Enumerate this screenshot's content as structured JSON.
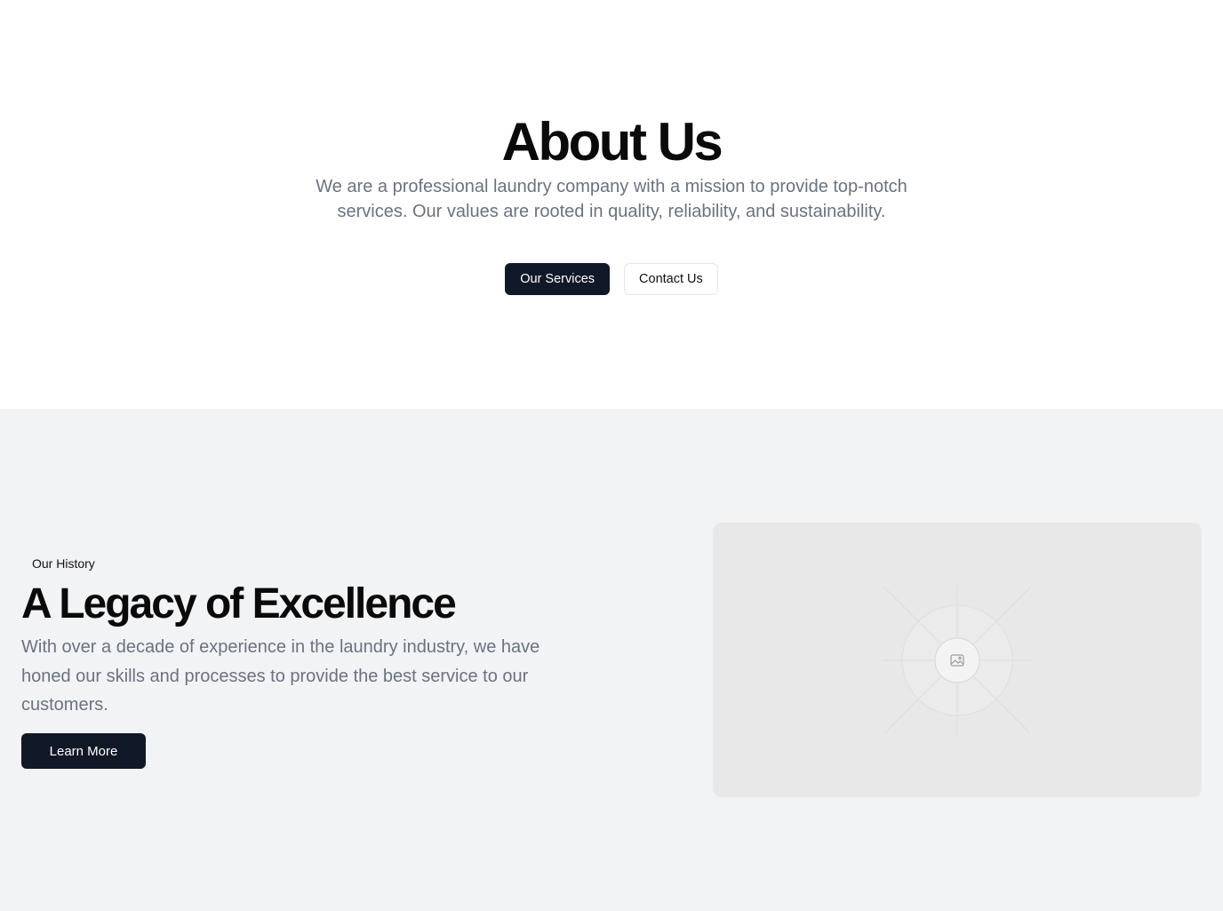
{
  "hero": {
    "title": "About Us",
    "description": "We are a professional laundry company with a mission to provide top-notch services. Our values are rooted in quality, reliability, and sustainability.",
    "primary_button": "Our Services",
    "secondary_button": "Contact Us"
  },
  "history": {
    "eyebrow": "Our History",
    "title": "A Legacy of Excellence",
    "description": "With over a decade of experience in the laundry industry, we have honed our skills and processes to provide the best service to our customers.",
    "button": "Learn More",
    "image_icon": "image-placeholder-icon"
  },
  "colors": {
    "dark_button": "#111827",
    "muted_text": "#6b7280",
    "section_bg": "#f2f3f5",
    "placeholder_bg": "#e8e8e8"
  }
}
